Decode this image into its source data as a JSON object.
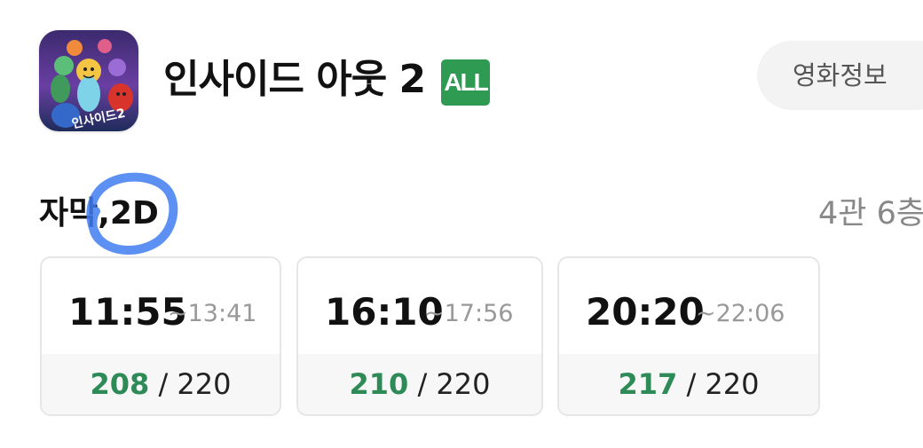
{
  "movie": {
    "title": "인사이드 아웃 2",
    "rating": "ALL",
    "info_button_label": "영화정보",
    "poster_text": "인사이드2"
  },
  "section": {
    "format": "자막,2D",
    "screen": "4관 6층"
  },
  "showtimes": [
    {
      "start": "11:55",
      "end": "~13:41",
      "seats_available": "208",
      "separator": " / ",
      "seats_total": "220"
    },
    {
      "start": "16:10",
      "end": "~17:56",
      "seats_available": "210",
      "separator": " / ",
      "seats_total": "220"
    },
    {
      "start": "20:20",
      "end": "~22:06",
      "seats_available": "217",
      "separator": " / ",
      "seats_total": "220"
    }
  ],
  "colors": {
    "rating_badge": "#2e9a52",
    "seats_available": "#2e8b57",
    "annotation_circle": "#3f7df0"
  }
}
